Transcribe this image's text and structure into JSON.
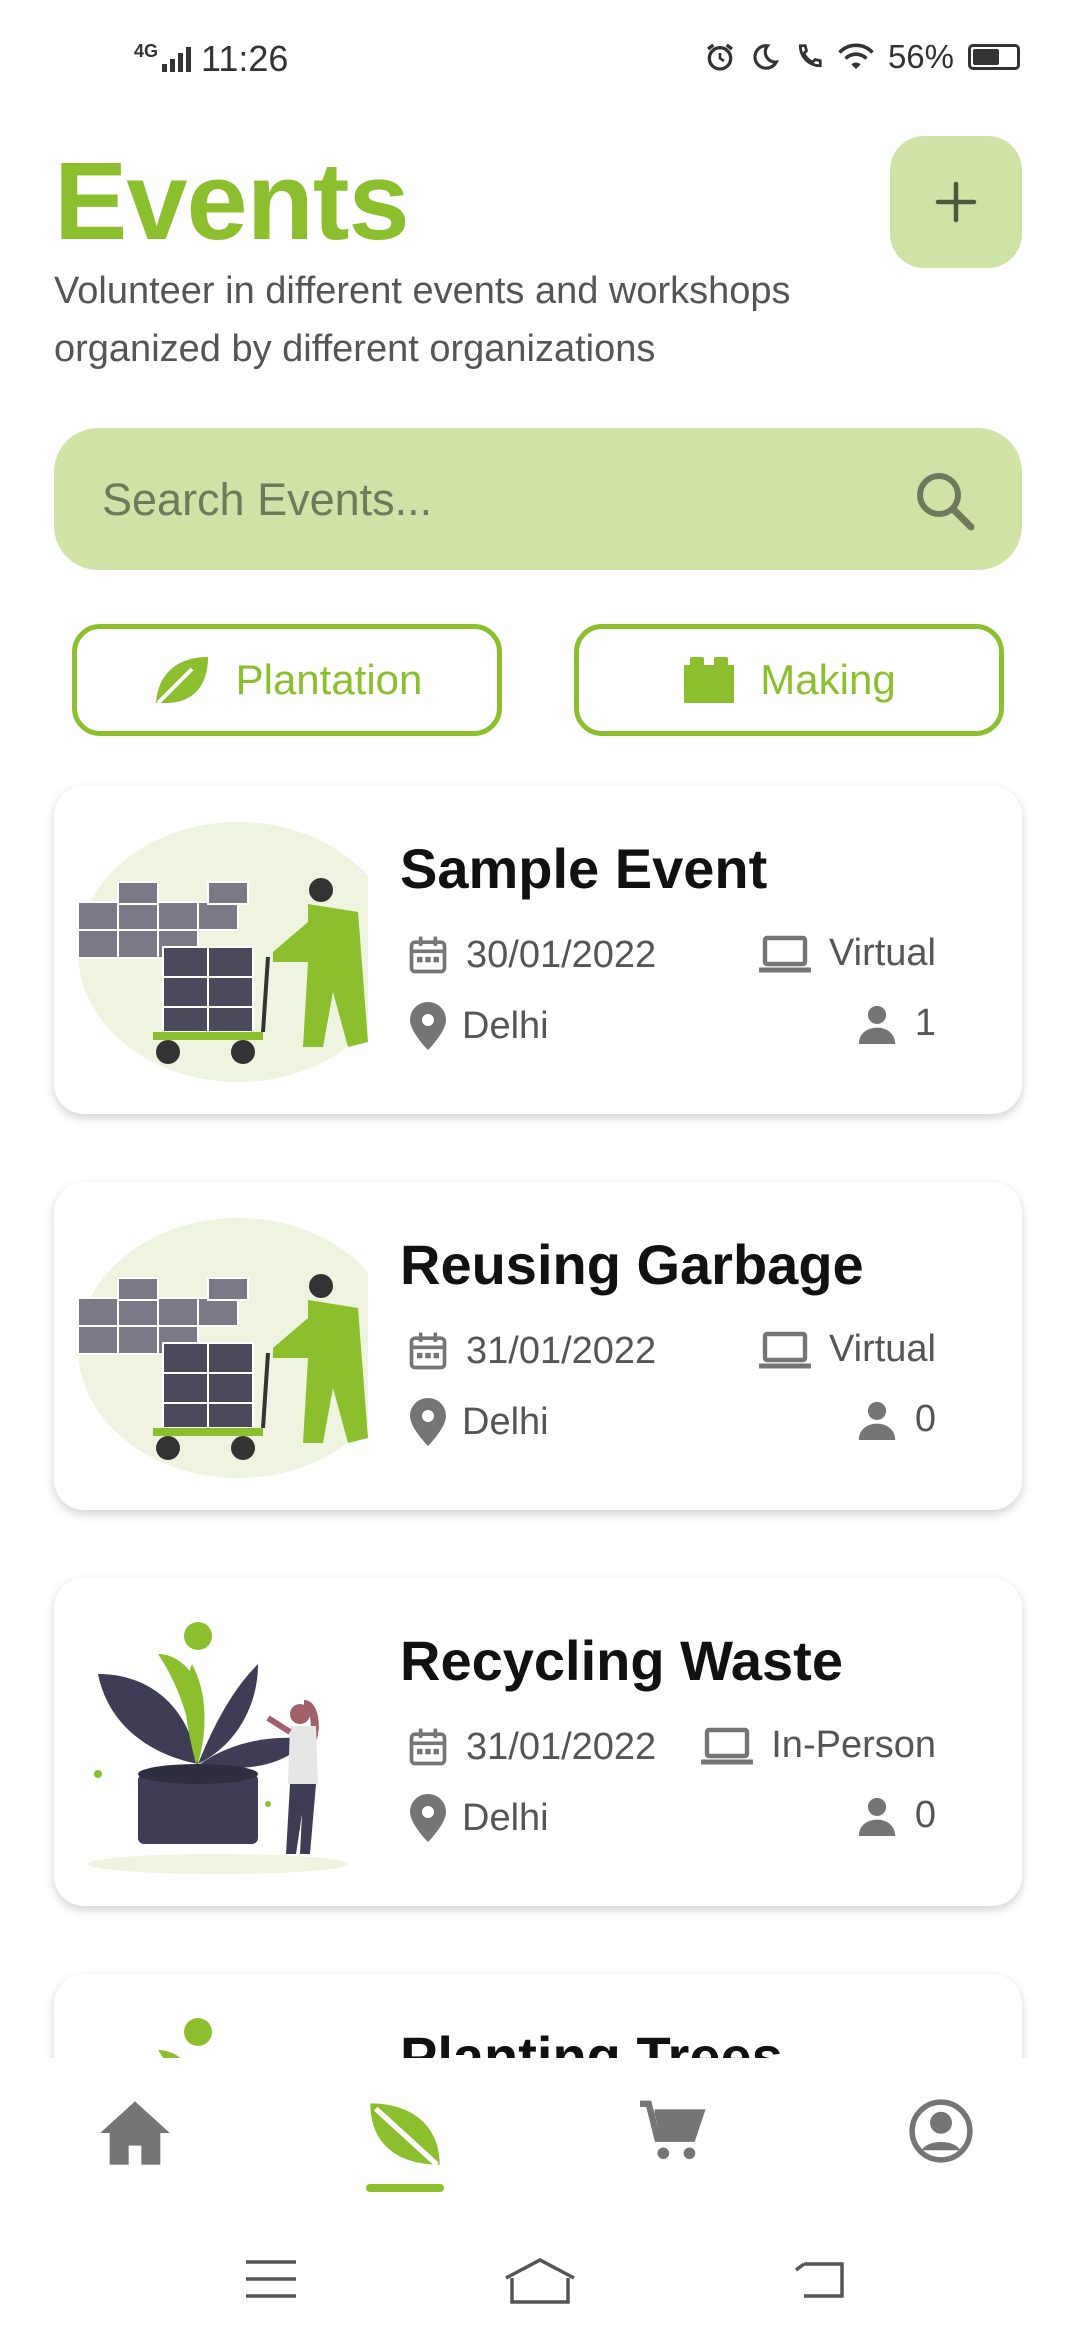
{
  "status_bar": {
    "network": "4G",
    "time": "11:26",
    "battery": "56%"
  },
  "header": {
    "title": "Events",
    "add_label": "+",
    "subtitle": "Volunteer in different events and workshops organized by different organizations"
  },
  "search": {
    "placeholder": "Search Events...",
    "icon": "search-icon"
  },
  "filters": [
    {
      "label": "Plantation",
      "icon": "leaf-icon"
    },
    {
      "label": "Making",
      "icon": "blocks-icon"
    }
  ],
  "events": [
    {
      "name": "Sample Event",
      "date": "30/01/2022",
      "mode": "Virtual",
      "location": "Delhi",
      "participants": "1",
      "illustration": "cart-worker"
    },
    {
      "name": "Reusing Garbage",
      "date": "31/01/2022",
      "mode": "Virtual",
      "location": "Delhi",
      "participants": "0",
      "illustration": "cart-worker"
    },
    {
      "name": "Recycling Waste",
      "date": "31/01/2022",
      "mode": "In-Person",
      "location": "Delhi",
      "participants": "0",
      "illustration": "plant-woman"
    },
    {
      "name": "Planting Trees",
      "illustration": "plant-woman"
    }
  ],
  "bottom_nav": [
    {
      "icon": "home-icon",
      "active": false
    },
    {
      "icon": "leaf-icon",
      "active": true
    },
    {
      "icon": "cart-icon",
      "active": false
    },
    {
      "icon": "profile-icon",
      "active": false
    }
  ],
  "colors": {
    "accent": "#8bbf2e",
    "accent_light": "#cfe3a7",
    "text_dark": "#111111",
    "text_muted": "#555555",
    "icon_gray": "#757575"
  }
}
